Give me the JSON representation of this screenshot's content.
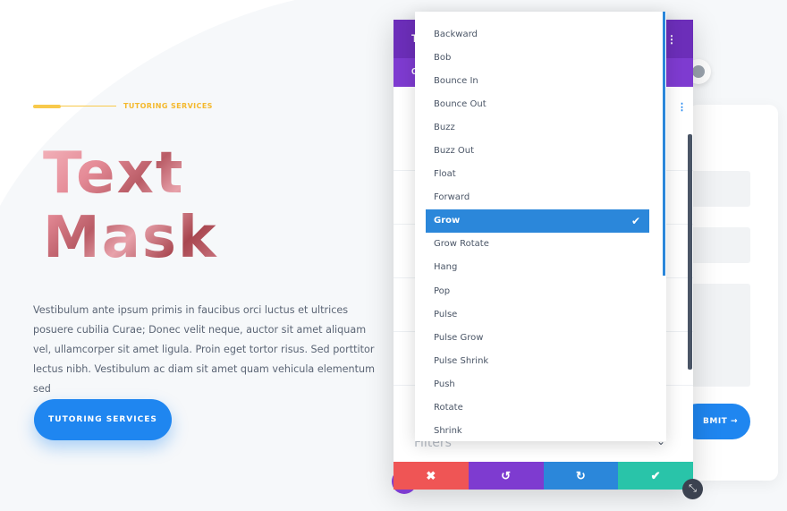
{
  "hero": {
    "eyebrow": "TUTORING SERVICES",
    "title_line1": "Text",
    "title_line2": "Mask",
    "body": "Vestibulum ante ipsum primis in faucibus orci luctus et ultrices posuere cubilia Curae; Donec velit neque, auctor sit amet aliquam vel, ullamcorper sit amet ligula. Proin eget tortor risus. Sed porttitor lectus nibh. Vestibulum ac diam sit amet quam vehicula elementum sed",
    "cta_label": "TUTORING SERVICES"
  },
  "form": {
    "submit_label": "BMIT →"
  },
  "modal": {
    "header_letter": "T",
    "tab_letter": "C",
    "header_menu_icon": "⋮",
    "side_menu_icon": "⋮",
    "filters_label": "Filters",
    "filters_chevron": "⌄",
    "footer": {
      "cancel_icon": "✖",
      "undo_icon": "↺",
      "redo_icon": "↻",
      "save_icon": "✔"
    },
    "resize_icon": "⤡"
  },
  "dropdown": {
    "selected": "Grow",
    "check_icon": "✔",
    "options": [
      "Backward",
      "Bob",
      "Bounce In",
      "Bounce Out",
      "Buzz",
      "Buzz Out",
      "Float",
      "Forward",
      "Grow",
      "Grow Rotate",
      "Hang",
      "Pop",
      "Pulse",
      "Pulse Grow",
      "Pulse Shrink",
      "Push",
      "Rotate",
      "Shrink"
    ]
  },
  "colors": {
    "accent_blue": "#1f86f0",
    "divi_purple": "#7e3bd0",
    "eyebrow_yellow": "#f4b92e",
    "cancel_red": "#ef5555",
    "save_teal": "#29c4a9"
  }
}
